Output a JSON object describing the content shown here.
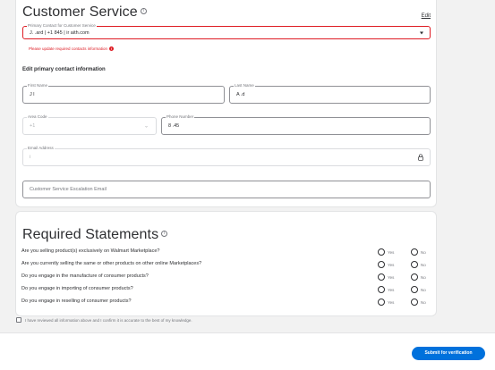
{
  "customer_service": {
    "title": "Customer Service",
    "edit_label": "Edit",
    "primary_contact": {
      "label": "Primary Contact for Customer Service",
      "value": "J.       .ard | +1         845 | ir                  aith.com",
      "error": "Please update required contacts information"
    },
    "edit_heading": "Edit primary contact information",
    "first_name": {
      "label": "First Name",
      "value": "J        l"
    },
    "last_name": {
      "label": "Last Name",
      "value": "A        .d"
    },
    "area_code": {
      "label": "Area Code",
      "value": "+1"
    },
    "phone_number": {
      "label": "Phone Number",
      "value": "8              .45"
    },
    "email": {
      "label": "Email Address",
      "value": "                          i"
    },
    "escalation": {
      "placeholder": "Customer Service Escalation Email"
    }
  },
  "required_statements": {
    "title": "Required Statements",
    "yes_label": "Yes",
    "no_label": "No",
    "questions": [
      "Are you selling product(s) exclusively on Walmart Marketplace?",
      "Are you currently selling the same or other products on other online Marketplaces?",
      "Do you engage in the manufacture of consumer products?",
      "Do you engage in importing of consumer products?",
      "Do you engage in reselling of consumer products?"
    ]
  },
  "confirmation": {
    "label": "I have reviewed all information above and I confirm it is accurate to the best of my knowledge."
  },
  "footer": {
    "submit_label": "Submit for verification"
  },
  "colors": {
    "accent": "#0071dc",
    "error": "#de1c24",
    "text": "#2e2f32"
  },
  "icons": [
    "info-icon",
    "error-icon",
    "caret-down-icon",
    "chevron-down-icon",
    "lock-icon"
  ]
}
